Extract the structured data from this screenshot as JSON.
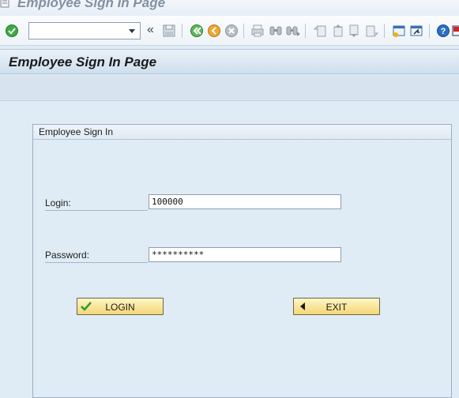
{
  "window": {
    "title": "Employee Sign In Page"
  },
  "toolbar": {
    "command_field_value": "",
    "chevron": "«",
    "icons": [
      "enter-icon",
      "save-icon",
      "back-icon",
      "exit-icon",
      "cancel-icon",
      "print-icon",
      "find-icon",
      "find-next-icon",
      "first-page-icon",
      "previous-page-icon",
      "next-page-icon",
      "last-page-icon",
      "create-session-icon",
      "shortcut-icon",
      "help-icon",
      "customize-layout-icon"
    ]
  },
  "page": {
    "title": "Employee Sign In Page"
  },
  "group": {
    "title": "Employee Sign In",
    "login_label": "Login:",
    "login_value": "100000",
    "password_label": "Password:",
    "password_value": "**********"
  },
  "buttons": {
    "login_label": "LOGIN",
    "exit_label": "EXIT"
  },
  "colors": {
    "background": "#dfebf5",
    "button_fill": "#f4d676",
    "enter_icon_green": "#2e9a35",
    "help_icon_blue": "#1f5fb0",
    "layout_icon_red": "#c8232c"
  }
}
